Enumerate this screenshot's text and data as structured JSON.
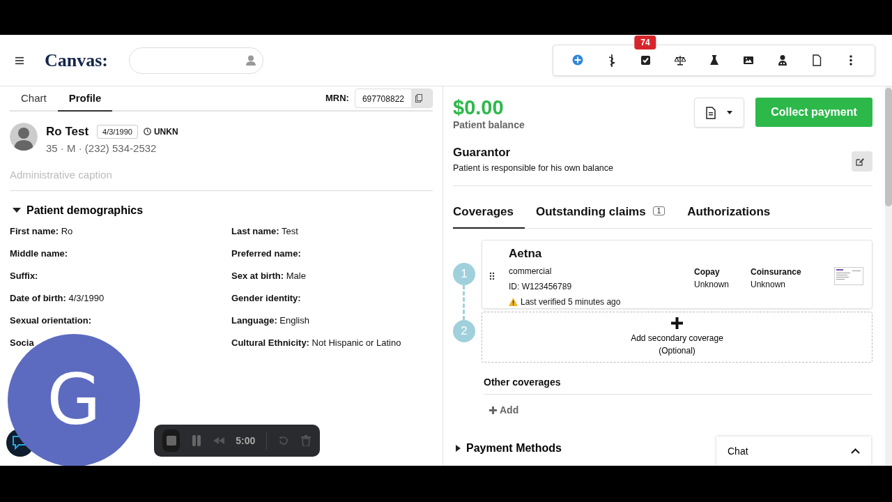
{
  "header": {
    "logo": "Canvas:",
    "toolbar_badge": "74"
  },
  "left_tabs": [
    {
      "label": "Chart",
      "selected": false
    },
    {
      "label": "Profile",
      "selected": true
    }
  ],
  "mrn": {
    "label": "MRN:",
    "value": "697708822"
  },
  "patient": {
    "name": "Ro Test",
    "dob": "4/3/1990",
    "timezone": "UNKN",
    "details": "35 · M · (232) 534-2532",
    "caption_placeholder": "Administrative caption"
  },
  "demographics": {
    "title": "Patient demographics",
    "expanded": true,
    "fields": [
      {
        "label": "First name:",
        "value": "Ro"
      },
      {
        "label": "Last name:",
        "value": "Test"
      },
      {
        "label": "Middle name:"
      },
      {
        "label": "Preferred name:"
      },
      {
        "label": "Suffix:"
      },
      {
        "label": "Sex at birth:",
        "value": "Male"
      },
      {
        "label": "Date of birth:",
        "value": "4/3/1990"
      },
      {
        "label": "Gender identity:"
      },
      {
        "label": "Sexual orientation:"
      },
      {
        "label": "Language:",
        "value": "English"
      },
      {
        "label": "Socia"
      },
      {
        "label": "Cultural Ethnicity:",
        "value": "Not Hispanic or Latino"
      }
    ]
  },
  "balance": {
    "amount": "$0.00",
    "label": "Patient balance",
    "collect_button": "Collect payment"
  },
  "guarantor": {
    "title": "Guarantor",
    "text": "Patient is responsible for his own balance"
  },
  "right_tabs": [
    {
      "label": "Coverages",
      "selected": true
    },
    {
      "label": "Outstanding claims",
      "count": "1",
      "selected": false
    },
    {
      "label": "Authorizations",
      "selected": false
    }
  ],
  "coverages": [
    {
      "rank": "1",
      "payer": "Aetna",
      "plan_type": "commercial",
      "member_id": "ID: W123456789",
      "verified": "Last verified 5 minutes ago",
      "copay_label": "Copay",
      "copay": "Unknown",
      "coinsurance_label": "Coinsurance",
      "coinsurance": "Unknown"
    }
  ],
  "secondary": {
    "rank": "2",
    "line1": "Add secondary coverage",
    "line2": "(Optional)"
  },
  "other_coverages": {
    "title": "Other coverages",
    "add": "Add"
  },
  "payment_methods": {
    "title": "Payment Methods",
    "expanded": false
  },
  "chat": {
    "label": "Chat"
  },
  "recorder": {
    "time": "5:00",
    "avatar_letter": "G"
  }
}
